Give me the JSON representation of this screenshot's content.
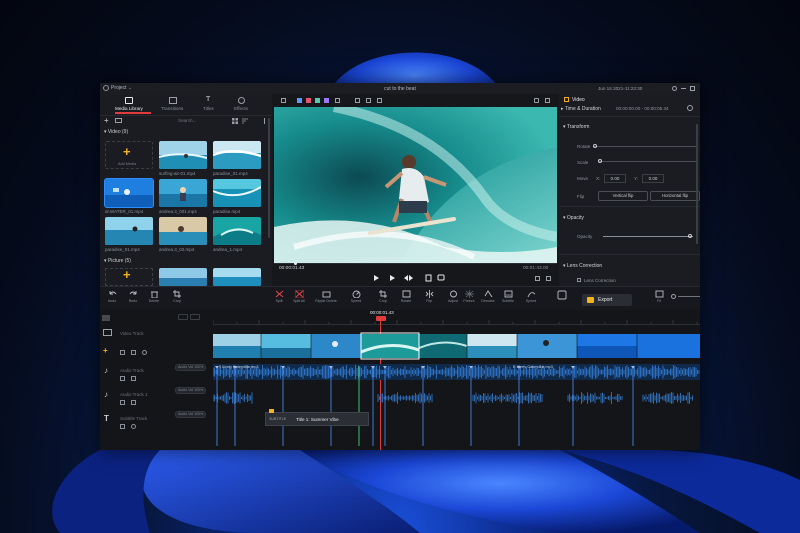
{
  "app": {
    "title": "cut to the beat",
    "project_menu": "Project",
    "date": "Jun 16 2021-11:23:30",
    "accent": "#2f8cff",
    "export_color": "#f3b31a"
  },
  "media": {
    "tabs": [
      "Media Library",
      "Transitions",
      "Titles",
      "Effects"
    ],
    "search_placeholder": "Search...",
    "video_section": "Video (9)",
    "picture_section": "Picture (5)",
    "add_label": "Add Media",
    "clips": [
      "surfing-air-01.mp4",
      "paradise_01.mp4",
      "dr.WATER_01.mp4",
      "andrea.3_001.mp4",
      "paradise.mp4",
      "paradise_01.mp4",
      "andrea.3_02.mp4",
      "andrea_1.mp4"
    ]
  },
  "preview": {
    "timecode": "00:00:01.43",
    "duration": "00:01:43.00"
  },
  "props": {
    "tab": "Video",
    "time_duration": "Time & Duration",
    "time_value": "00:00:00.00 - 00:00:05.34",
    "transform": "Transform",
    "rotate": "Rotate",
    "scale": "Scale",
    "move": "Move",
    "move_x_label": "X:",
    "move_x": "0.00",
    "move_y_label": "Y:",
    "move_y": "0.00",
    "flip": "Flip",
    "vertical_flip": "Vertical flip",
    "horizontal_flip": "Horizontal flip",
    "opacity_section": "Opacity",
    "opacity": "Opacity",
    "lens_correction": "Lens Correction",
    "lens_check": "Lens Correction"
  },
  "toolbar": {
    "left": [
      "Undo",
      "Redo",
      "Delete",
      "Crop"
    ],
    "center": [
      "Split",
      "Split All",
      "Ripple Delete",
      "Speed",
      "Crop",
      "Rotate",
      "Flip",
      "Adjust",
      "Freeze",
      "Denoise",
      "Subtitle",
      "Speed"
    ],
    "export": "Export",
    "fit": "Fit"
  },
  "timeline": {
    "playhead": "00:00:01.43",
    "tracks": [
      "Video Track",
      "Audio Track",
      "Audio Track 1",
      "Subtitle Track"
    ],
    "audio_clip": "5 Lively Caterpillar.mp3",
    "audio_clip2": "B Lively Caterpillar.mp3",
    "audio_pill": "Audio Vol 100%",
    "subtitle_clip": "Title 1: Summer Vibe",
    "subtitle_tag": "SUBTITLE"
  }
}
